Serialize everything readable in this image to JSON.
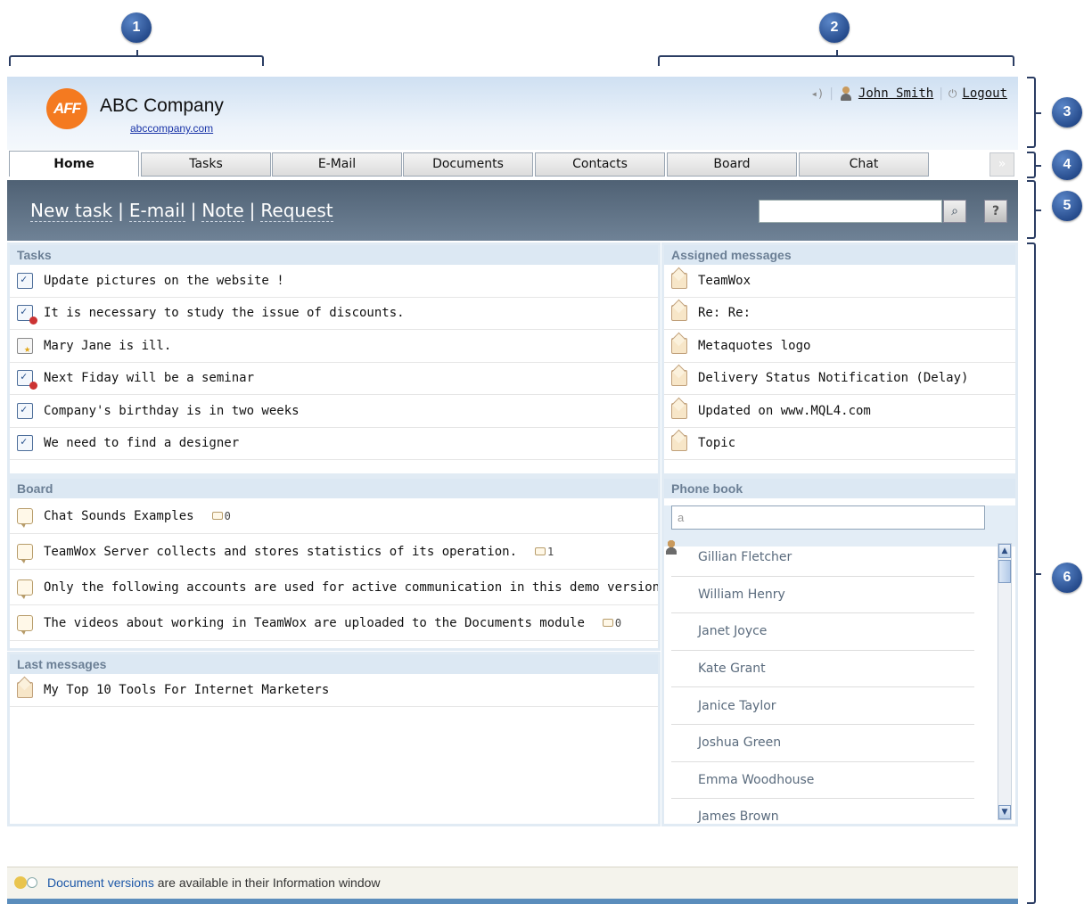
{
  "callouts": [
    "1",
    "2",
    "3",
    "4",
    "5",
    "6"
  ],
  "header": {
    "logo_text": "AFF",
    "company_name": "ABC Company",
    "company_url": "abccompany.com",
    "user_name": "John Smith",
    "logout_label": "Logout"
  },
  "tabs": [
    {
      "label": "Home",
      "active": true
    },
    {
      "label": "Tasks"
    },
    {
      "label": "E-Mail"
    },
    {
      "label": "Documents"
    },
    {
      "label": "Contacts"
    },
    {
      "label": "Board"
    },
    {
      "label": "Chat"
    }
  ],
  "tab_more": "»",
  "toolbar": {
    "new_task": "New task",
    "email": "E-mail",
    "note": "Note",
    "request": "Request",
    "search_value": "",
    "help_label": "?"
  },
  "tasks": {
    "title": "Tasks",
    "items": [
      {
        "text": "Update pictures on the website !",
        "icon": "task-icon"
      },
      {
        "text": "It is necessary to study the issue of discounts.",
        "icon": "task-alert-icon"
      },
      {
        "text": "Mary Jane is ill.",
        "icon": "task-star-icon"
      },
      {
        "text": "Next Fiday will be a seminar",
        "icon": "task-alert-icon"
      },
      {
        "text": "Company's birthday is in two weeks",
        "icon": "task-icon"
      },
      {
        "text": "We need to find a designer",
        "icon": "task-icon"
      }
    ]
  },
  "assigned": {
    "title": "Assigned messages",
    "items": [
      "TeamWox",
      "Re: Re:",
      "Metaquotes logo",
      "Delivery Status Notification (Delay)",
      "Updated on www.MQL4.com",
      "Topic"
    ]
  },
  "board": {
    "title": "Board",
    "items": [
      {
        "text": "Chat Sounds Examples",
        "comments": "0"
      },
      {
        "text": "TeamWox Server collects and stores statistics of its operation.",
        "comments": "1"
      },
      {
        "text": "Only the following accounts are used for active communication in this demo version of TeamWox",
        "comments": ""
      },
      {
        "text": "The videos about working in TeamWox are uploaded to the Documents module",
        "comments": "0"
      }
    ]
  },
  "last_messages": {
    "title": "Last messages",
    "items": [
      "My Top 10 Tools For Internet Marketers"
    ]
  },
  "phonebook": {
    "title": "Phone book",
    "search_value": "a",
    "contacts": [
      "Gillian Fletcher",
      "William Henry",
      "Janet Joyce",
      "Kate Grant",
      "Janice Taylor",
      "Joshua Green",
      "Emma Woodhouse",
      "James Brown"
    ]
  },
  "infobar": {
    "link": "Document versions",
    "text": " are available in their Information window"
  }
}
